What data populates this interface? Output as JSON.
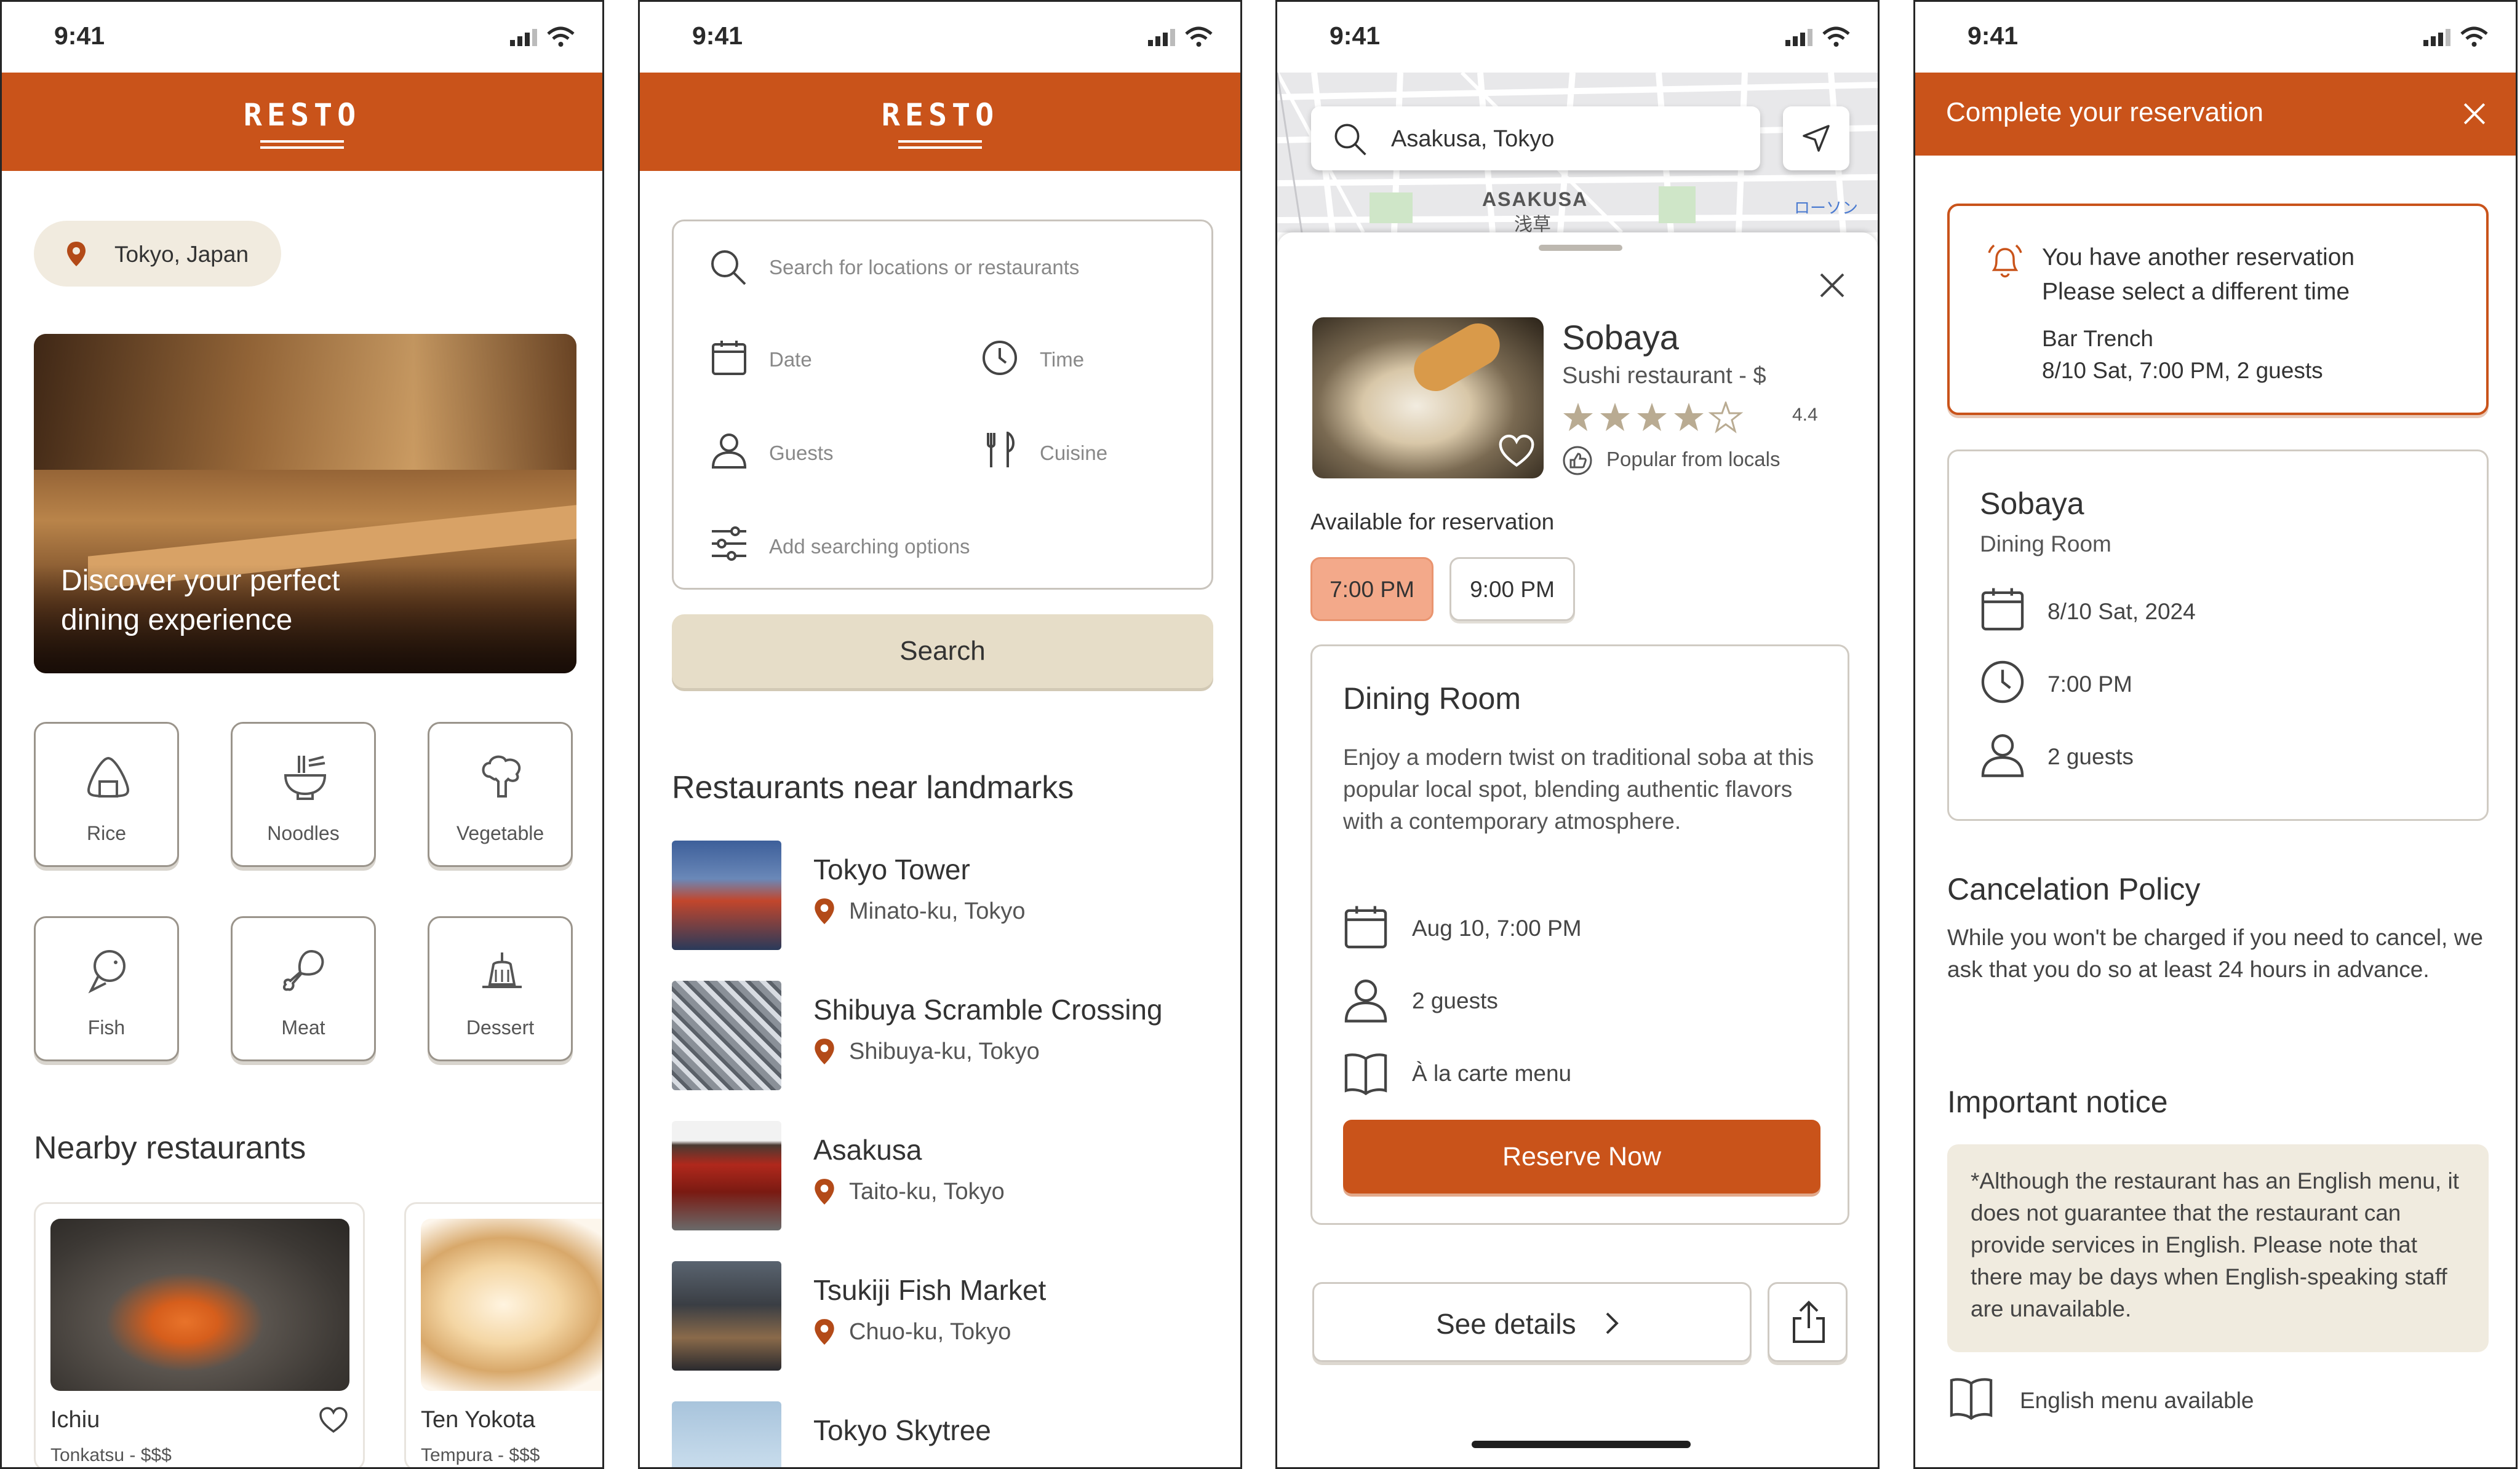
{
  "status": {
    "time": "9:41"
  },
  "screen1": {
    "brand": "RESTO",
    "location": "Tokyo, Japan",
    "hero_caption": "Discover your perfect dining experience",
    "categories": [
      {
        "label": "Rice",
        "icon": "onigiri-icon"
      },
      {
        "label": "Noodles",
        "icon": "noodle-bowl-icon"
      },
      {
        "label": "Vegetable",
        "icon": "broccoli-icon"
      },
      {
        "label": "Fish",
        "icon": "fish-icon"
      },
      {
        "label": "Meat",
        "icon": "drumstick-icon"
      },
      {
        "label": "Dessert",
        "icon": "pudding-icon"
      }
    ],
    "nearby_title": "Nearby restaurants",
    "restaurants": [
      {
        "name": "Ichiu",
        "sub": "Tonkatsu - $$$"
      },
      {
        "name": "Ten Yokota",
        "sub": "Tempura  - $$$"
      }
    ]
  },
  "screen2": {
    "brand": "RESTO",
    "search_placeholder": "Search for locations or restaurants",
    "date_label": "Date",
    "time_label": "Time",
    "guests_label": "Guests",
    "cuisine_label": "Cuisine",
    "options_label": "Add searching options",
    "search_button": "Search",
    "landmarks_title": "Restaurants near landmarks",
    "landmarks": [
      {
        "name": "Tokyo Tower",
        "area": "Minato-ku, Tokyo"
      },
      {
        "name": "Shibuya Scramble Crossing",
        "area": "Shibuya-ku, Tokyo"
      },
      {
        "name": "Asakusa",
        "area": "Taito-ku, Tokyo"
      },
      {
        "name": "Tsukiji Fish Market",
        "area": "Chuo-ku, Tokyo"
      },
      {
        "name": "Tokyo Skytree",
        "area": ""
      }
    ]
  },
  "screen3": {
    "map_search": "Asakusa, Tokyo",
    "map_label_en": "ASAKUSA",
    "map_label_jp": "浅草",
    "map_label_store": "ローソン",
    "restaurant_name": "Sobaya",
    "restaurant_type": "Sushi restaurant - $",
    "rating": "4.4",
    "rating_value": 4.4,
    "popular": "Popular from locals",
    "available_label": "Available for reservation",
    "times": [
      {
        "label": "7:00 PM",
        "selected": true
      },
      {
        "label": "9:00 PM",
        "selected": false
      }
    ],
    "room_title": "Dining Room",
    "room_desc": "Enjoy a modern twist on traditional soba at this popular local spot, blending authentic flavors with a contemporary atmosphere.",
    "date_time": "Aug 10, 7:00 PM",
    "guests": "2 guests",
    "menu": "À la carte menu",
    "reserve_button": "Reserve Now",
    "details_button": "See details"
  },
  "screen4": {
    "title": "Complete your reservation",
    "alert_line1": "You have another reservation",
    "alert_line2": "Please select a different time",
    "alert_place": "Bar Trench",
    "alert_when": "8/10 Sat, 7:00 PM, 2 guests",
    "rest_name": "Sobaya",
    "room": "Dining Room",
    "date": "8/10 Sat, 2024",
    "time": "7:00 PM",
    "guests": "2 guests",
    "cancel_title": "Cancelation Policy",
    "cancel_text": "While you won't be charged if you need to cancel, we ask that you do so at least 24 hours in advance.",
    "notice_title": "Important notice",
    "notice_text": "*Although the restaurant has an English menu, it does not guarantee that the restaurant can provide services in English. Please note that there may be days when English-speaking staff are unavailable.",
    "english_menu": "English menu available"
  },
  "colors": {
    "accent": "#c9531a",
    "chip_selected": "#f3a98a",
    "beige": "#e6ddc8",
    "pill": "#f1ebdf"
  }
}
